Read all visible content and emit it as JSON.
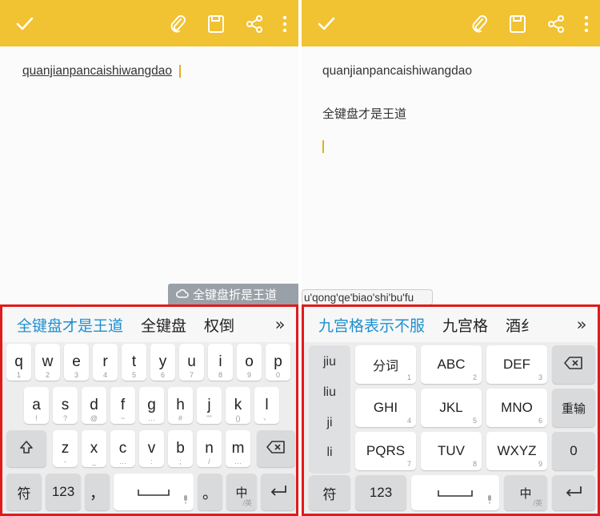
{
  "left": {
    "note": {
      "text": "quanjianpancaishiwangdao"
    },
    "hint": {
      "text": "全键盘折是王道"
    },
    "candidates": [
      "全键盘才是王道",
      "全键盘",
      "权倒"
    ],
    "more_label": "»",
    "rows": [
      [
        {
          "k": "q",
          "s": "1"
        },
        {
          "k": "w",
          "s": "2"
        },
        {
          "k": "e",
          "s": "3"
        },
        {
          "k": "r",
          "s": "4"
        },
        {
          "k": "t",
          "s": "5"
        },
        {
          "k": "y",
          "s": "6"
        },
        {
          "k": "u",
          "s": "7"
        },
        {
          "k": "i",
          "s": "8"
        },
        {
          "k": "o",
          "s": "9"
        },
        {
          "k": "p",
          "s": "0"
        }
      ],
      [
        {
          "k": "a",
          "s": "!"
        },
        {
          "k": "s",
          "s": "?"
        },
        {
          "k": "d",
          "s": "@"
        },
        {
          "k": "f",
          "s": "~"
        },
        {
          "k": "g",
          "s": "…"
        },
        {
          "k": "h",
          "s": "#"
        },
        {
          "k": "j",
          "s": "\"\""
        },
        {
          "k": "k",
          "s": "()"
        },
        {
          "k": "l",
          "s": "、"
        }
      ],
      [
        {
          "k": "z",
          "s": "-"
        },
        {
          "k": "x",
          "s": "_"
        },
        {
          "k": "c",
          "s": "…"
        },
        {
          "k": "v",
          "s": ":"
        },
        {
          "k": "b",
          "s": ";"
        },
        {
          "k": "n",
          "s": "/"
        },
        {
          "k": "m",
          "s": "…"
        }
      ]
    ],
    "bottom": {
      "sym": "符",
      "num": "123",
      "comma": "，",
      "period": "。",
      "lang": "中",
      "lang_sub": "/英"
    }
  },
  "right": {
    "note": {
      "line1": "quanjianpancaishiwangdao",
      "line2": "全键盘才是王道"
    },
    "hint": {
      "text": "u'qong'qe'biao'shi'bu'fu"
    },
    "candidates": [
      "九宫格表示不服",
      "九宫格",
      "酒纟"
    ],
    "more_label": "»",
    "pinyin": [
      "jiu",
      "liu",
      "ji",
      "li"
    ],
    "keys": [
      [
        {
          "k": "分词",
          "s": "1"
        },
        {
          "k": "ABC",
          "s": "2"
        },
        {
          "k": "DEF",
          "s": "3"
        }
      ],
      [
        {
          "k": "GHI",
          "s": "4"
        },
        {
          "k": "JKL",
          "s": "5"
        },
        {
          "k": "MNO",
          "s": "6"
        }
      ],
      [
        {
          "k": "PQRS",
          "s": "7"
        },
        {
          "k": "TUV",
          "s": "8"
        },
        {
          "k": "WXYZ",
          "s": "9"
        }
      ]
    ],
    "side": {
      "retype": "重输",
      "zero": "0"
    },
    "bottom": {
      "sym": "符",
      "num": "123",
      "lang": "中",
      "lang_sub": "/英"
    }
  },
  "colors": {
    "toolbar": "#f1c232",
    "accent": "#1e8fd0",
    "frame": "#e01b1b",
    "cursor": "#e6ad1f"
  },
  "icons": [
    "check-icon",
    "paperclip-icon",
    "save-icon",
    "share-icon",
    "more-vert-icon",
    "cloud-icon",
    "shift-icon",
    "backspace-icon",
    "enter-icon",
    "mic-icon"
  ]
}
